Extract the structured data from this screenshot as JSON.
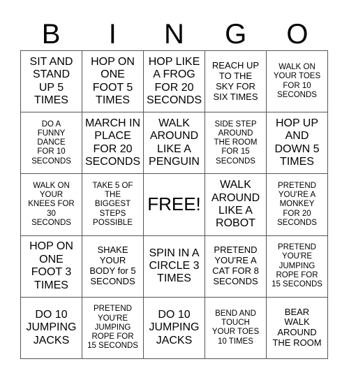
{
  "title_letters": [
    "B",
    "I",
    "N",
    "G",
    "O"
  ],
  "rows": [
    [
      {
        "text": "SIT AND\nSTAND\nUP 5\nTIMES",
        "size": "l"
      },
      {
        "text": "HOP ON\nONE\nFOOT 5\nTIMES",
        "size": "l"
      },
      {
        "text": "HOP LIKE\nA FROG\nFOR 20\nSECONDS",
        "size": "l"
      },
      {
        "text": "REACH UP\nTO THE\nSKY FOR\nSIX TIMES",
        "size": "m"
      },
      {
        "text": "WALK ON\nYOUR TOES\nFOR 10\nSECONDS",
        "size": "s"
      }
    ],
    [
      {
        "text": "DO A\nFUNNY\nDANCE\nFOR 10\nSECONDS",
        "size": "s"
      },
      {
        "text": "MARCH IN\nPLACE\nFOR 20\nSECONDS",
        "size": "l"
      },
      {
        "text": "WALK\nAROUND\nLIKE A\nPENGUIN",
        "size": "l"
      },
      {
        "text": "SIDE STEP\nAROUND\nTHE ROOM\nFOR 15\nSECONDS",
        "size": "s"
      },
      {
        "text": "HOP UP\nAND\nDOWN 5\nTIMES",
        "size": "l"
      }
    ],
    [
      {
        "text": "WALK ON\nYOUR\nKNEES FOR\n30\nSECONDS",
        "size": "s"
      },
      {
        "text": "TAKE 5 OF\nTHE\nBIGGEST\nSTEPS\nPOSSIBLE",
        "size": "s"
      },
      {
        "text": "FREE!",
        "size": "free"
      },
      {
        "text": "WALK\nAROUND\nLIKE A\nROBOT",
        "size": "l"
      },
      {
        "text": "PRETEND\nYOU'RE A\nMONKEY\nFOR 20\nSECONDS",
        "size": "s"
      }
    ],
    [
      {
        "text": "HOP ON\nONE\nFOOT 3\nTIMES",
        "size": "l"
      },
      {
        "text": "SHAKE\nYOUR\nBODY for 5\nSECONDS",
        "size": "m"
      },
      {
        "text": "SPIN IN A\nCIRCLE 3\nTIMES",
        "size": "l"
      },
      {
        "text": "PRETEND\nYOU'RE A\nCAT FOR 8\nSECONDS",
        "size": "m"
      },
      {
        "text": "PRETEND\nYOU'RE\nJUMPING\nROPE FOR\n15 SECONDS",
        "size": "s"
      }
    ],
    [
      {
        "text": "DO 10\nJUMPING\nJACKS",
        "size": "l"
      },
      {
        "text": "PRETEND\nYOU'RE\nJUMPING\nROPE FOR\n15 SECONDS",
        "size": "s"
      },
      {
        "text": "DO 10\nJUMPING\nJACKS",
        "size": "l"
      },
      {
        "text": "BEND AND\nTOUCH\nYOUR TOES\n10 TIMES",
        "size": "s"
      },
      {
        "text": "BEAR\nWALK\nAROUND\nTHE ROOM",
        "size": "m"
      }
    ]
  ]
}
